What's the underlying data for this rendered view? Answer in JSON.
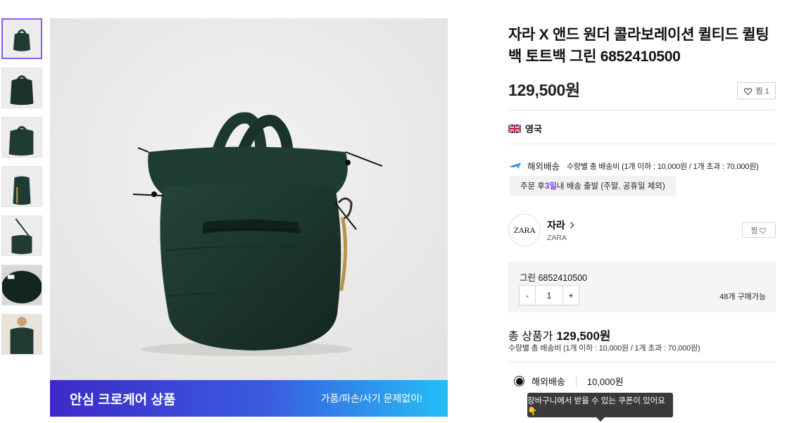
{
  "product": {
    "title": "자라 X 앤드 원더 콜라보레이션 퀼티드 퀼팅 백 토트백 그린 6852410500",
    "price": "129,500원",
    "wish_label": "찜 1"
  },
  "origin": {
    "flag_icon": "uk-flag-icon",
    "country": "영국"
  },
  "shipping": {
    "label": "해외배송",
    "detail": "수량별 총 배송비 (1개 이하 : 10,000원 / 1개 초과 : 70,000원)",
    "dispatch_pre": "주문 후 ",
    "dispatch_days": "3일",
    "dispatch_post": " 내 배송 출발 (주말, 공휴일 제외)"
  },
  "brand": {
    "logo_text": "ZARA",
    "name": "자라",
    "sub": "ZARA",
    "wish_label": "찜"
  },
  "option": {
    "name": "그린 6852410500",
    "minus": "-",
    "quantity": "1",
    "plus": "+",
    "stock": "48개 구매가능"
  },
  "total": {
    "label": "총 상품가",
    "amount": "129,500원",
    "sub": "수량별 총 배송비 (1개 이하 : 10,000원 / 1개 초과 : 70,000원)"
  },
  "ship_option": {
    "label": "해외배송",
    "price": "10,000원"
  },
  "tooltip": "장바구니에서 받을 수 있는 쿠폰이 있어요👇",
  "banner": {
    "title": "안심 크로케어 상품",
    "sub": "가품/파손/사기 문제없이!"
  },
  "colors": {
    "accent": "#8b5cf6",
    "bag": "#1f3b33",
    "banner_start": "#3c2ac8",
    "banner_end": "#23bff5"
  }
}
